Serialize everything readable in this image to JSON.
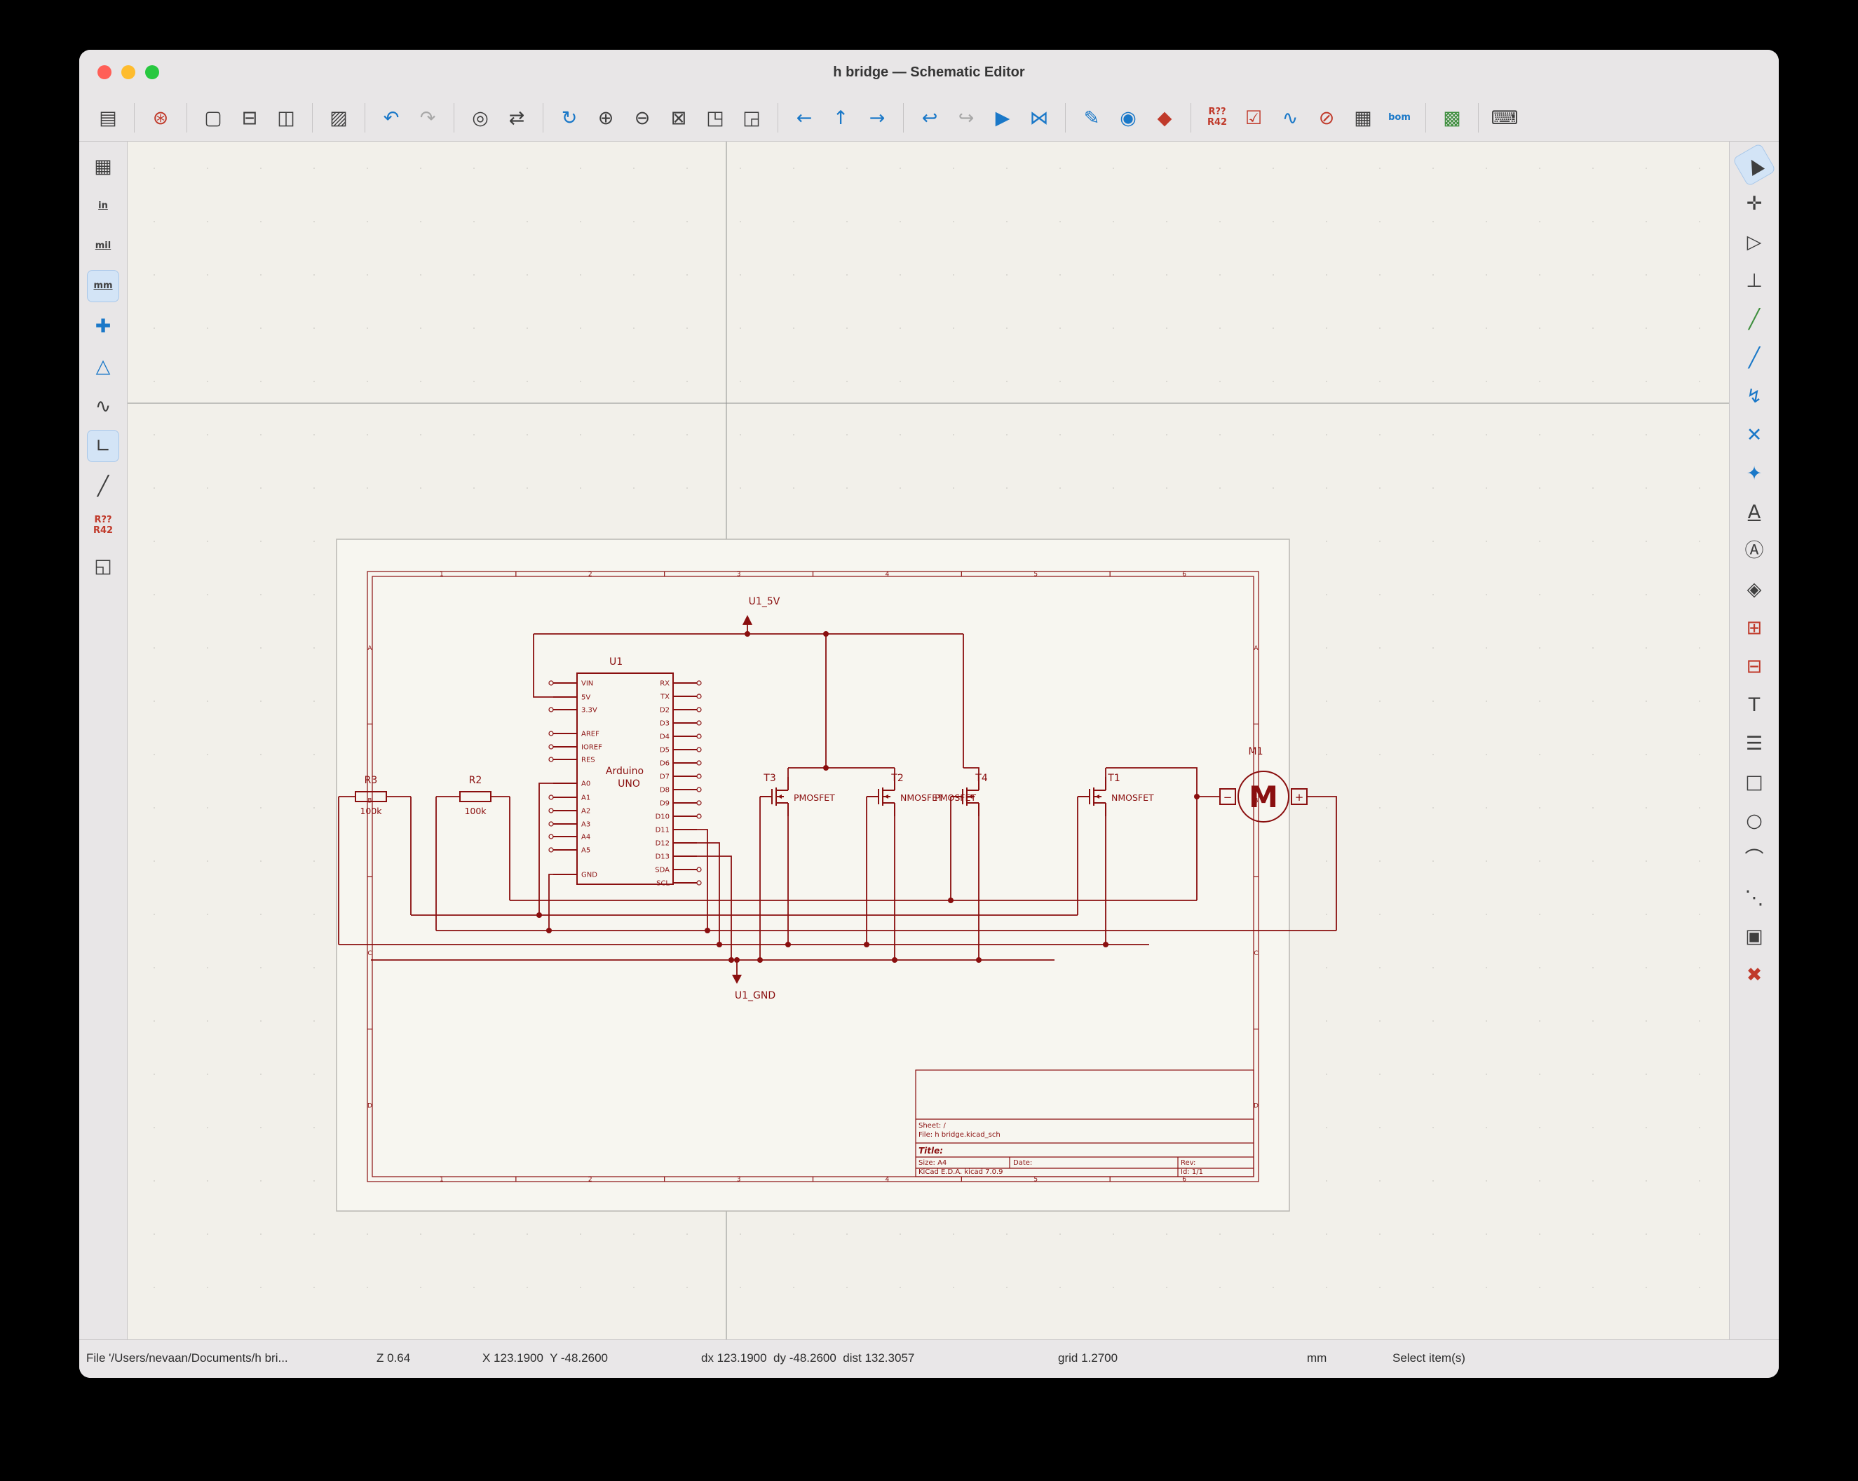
{
  "window": {
    "title": "h bridge — Schematic Editor"
  },
  "colors": {
    "schematic_stroke": "#8a0f0f",
    "titlebar_close": "#ff5f57",
    "titlebar_minimize": "#febc2e",
    "titlebar_maximize": "#28c840",
    "selected_tool_bg": "#d3e4f6",
    "toolbar_icon_blue": "#1a78c8",
    "toolbar_icon_red": "#c03a2b"
  },
  "toolbars": {
    "top": [
      {
        "n": "save-button",
        "g": "▤"
      },
      {
        "sep": true
      },
      {
        "n": "schematic-setup-button",
        "g": "⊛",
        "c": "r"
      },
      {
        "sep": true
      },
      {
        "n": "page-settings-button",
        "g": "▢"
      },
      {
        "n": "print-button",
        "g": "⊟"
      },
      {
        "n": "plot-button",
        "g": "◫"
      },
      {
        "sep": true
      },
      {
        "n": "paste-button",
        "g": "▨"
      },
      {
        "sep": true
      },
      {
        "n": "undo-button",
        "g": "↶",
        "c": "b"
      },
      {
        "n": "redo-button",
        "g": "↷",
        "c": "mut"
      },
      {
        "sep": true
      },
      {
        "n": "find-button",
        "g": "◎"
      },
      {
        "n": "find-replace-button",
        "g": "⇄"
      },
      {
        "sep": true
      },
      {
        "n": "refresh-button",
        "g": "↻",
        "c": "b"
      },
      {
        "n": "zoom-in-button",
        "g": "⊕"
      },
      {
        "n": "zoom-out-button",
        "g": "⊖"
      },
      {
        "n": "zoom-fit-button",
        "g": "⊠"
      },
      {
        "n": "zoom-objects-button",
        "g": "◳"
      },
      {
        "n": "zoom-selection-button",
        "g": "◲"
      },
      {
        "sep": true
      },
      {
        "n": "nav-back-button",
        "g": "←",
        "c": "b"
      },
      {
        "n": "nav-up-button",
        "g": "↑",
        "c": "b"
      },
      {
        "n": "nav-forward-button",
        "g": "→",
        "c": "b"
      },
      {
        "sep": true
      },
      {
        "n": "leave-sheet-button",
        "g": "↩",
        "c": "b"
      },
      {
        "n": "enter-sheet-button",
        "g": "↪",
        "c": "mut"
      },
      {
        "n": "navigate-hierarchy-button",
        "g": "▶",
        "c": "b"
      },
      {
        "n": "mirror-button",
        "g": "⋈",
        "c": "b"
      },
      {
        "sep": true
      },
      {
        "n": "annotate-button",
        "g": "✎",
        "c": "b"
      },
      {
        "n": "symbol-library-browser-button",
        "g": "◉",
        "c": "b"
      },
      {
        "n": "edit-symbol-fields-button",
        "g": "◆",
        "c": "r"
      },
      {
        "sep": true
      },
      {
        "n": "annotate-symbols-button",
        "lines": [
          "R??",
          "R42"
        ],
        "c": "r"
      },
      {
        "n": "erc-button",
        "g": "☑",
        "c": "r"
      },
      {
        "n": "simulator-button",
        "g": "∿",
        "c": "b"
      },
      {
        "n": "erc-rules-button",
        "g": "⊘",
        "c": "r"
      },
      {
        "n": "symbol-fields-table-button",
        "g": "▦"
      },
      {
        "n": "bom-button",
        "lines": [
          "bom"
        ],
        "c": "b"
      },
      {
        "sep": true
      },
      {
        "n": "open-pcb-button",
        "g": "▩",
        "c": "g"
      },
      {
        "sep": true
      },
      {
        "n": "python-console-button",
        "g": "⌨"
      }
    ],
    "left": [
      {
        "n": "grid-settings-button",
        "g": "▦"
      },
      {
        "n": "units-inches-button",
        "lines": [
          "in"
        ],
        "v": "u"
      },
      {
        "n": "units-mils-button",
        "lines": [
          "mil"
        ],
        "v": "u"
      },
      {
        "n": "units-mm-button",
        "lines": [
          "mm"
        ],
        "v": "u",
        "sel": true
      },
      {
        "n": "cursor-shape-button",
        "g": "✚",
        "c": "b"
      },
      {
        "n": "hidden-pins-button",
        "g": "△",
        "c": "b"
      },
      {
        "n": "sim-probe-button",
        "g": "∿"
      },
      {
        "n": "hv-wires-button",
        "g": "∟",
        "sel": true
      },
      {
        "n": "free-angle-wires-button",
        "g": "╱"
      },
      {
        "n": "annotate-auto-button",
        "lines": [
          "R??",
          "R42"
        ],
        "c": "r"
      },
      {
        "n": "hierarchy-navigator-button",
        "g": "◱"
      }
    ],
    "right": [
      {
        "n": "select-tool",
        "g": "▲",
        "v": "cur",
        "sel": true
      },
      {
        "n": "highlight-net-tool",
        "g": "✛"
      },
      {
        "n": "place-symbol-tool",
        "g": "▷"
      },
      {
        "n": "place-power-tool",
        "g": "⊥"
      },
      {
        "n": "wire-tool",
        "g": "╱",
        "c": "g"
      },
      {
        "n": "bus-tool",
        "g": "╱",
        "c": "b"
      },
      {
        "n": "bus-entry-tool",
        "g": "↯",
        "c": "b"
      },
      {
        "n": "no-connect-tool",
        "g": "✕",
        "c": "b"
      },
      {
        "n": "junction-tool",
        "g": "✦",
        "c": "b"
      },
      {
        "n": "net-label-tool",
        "g": "A",
        "v": "u"
      },
      {
        "n": "global-label-tool",
        "g": "Ⓐ"
      },
      {
        "n": "hierarchical-label-tool",
        "g": "◈"
      },
      {
        "n": "sheet-tool",
        "g": "⊞",
        "c": "r"
      },
      {
        "n": "sheet-pin-tool",
        "g": "⊟",
        "c": "r"
      },
      {
        "n": "text-tool",
        "g": "T"
      },
      {
        "n": "textbox-tool",
        "g": "☰"
      },
      {
        "n": "rectangle-tool",
        "g": "□"
      },
      {
        "n": "circle-tool",
        "g": "○"
      },
      {
        "n": "arc-tool",
        "g": "⌒"
      },
      {
        "n": "polygon-tool",
        "g": "⋱"
      },
      {
        "n": "image-tool",
        "g": "▣"
      },
      {
        "n": "delete-tool",
        "g": "✖",
        "c": "r"
      }
    ]
  },
  "schematic": {
    "power_5v": "U1_5V",
    "power_gnd": "U1_GND",
    "u1": {
      "ref": "U1",
      "value_line1": "Arduino",
      "value_line2": "UNO",
      "left_pins": [
        "VIN",
        "5V",
        "3.3V",
        "AREF",
        "IOREF",
        "RES",
        "A0",
        "A1",
        "A2",
        "A3",
        "A4",
        "A5",
        "GND"
      ],
      "right_pins": [
        "RX",
        "TX",
        "D2",
        "D3",
        "D4",
        "D5",
        "D6",
        "D7",
        "D8",
        "D9",
        "D10",
        "D11",
        "D12",
        "D13",
        "SDA",
        "SCL"
      ]
    },
    "r3": {
      "ref": "R3",
      "value": "100k"
    },
    "r2": {
      "ref": "R2",
      "value": "100k"
    },
    "transistors": [
      {
        "ref": "T3",
        "value": "PMOSFET"
      },
      {
        "ref": "T2",
        "value": "NMOSFET"
      },
      {
        "ref": "T4",
        "value": "PMOSFET"
      },
      {
        "ref": "T1",
        "value": "NMOSFET"
      }
    ],
    "motor": {
      "ref": "M1",
      "letter": "M",
      "plus": "+",
      "minus": "−"
    },
    "frame": {
      "cols": [
        "1",
        "2",
        "3",
        "4",
        "5",
        "6"
      ],
      "rows": [
        "A",
        "B",
        "C",
        "D"
      ]
    },
    "title_block": {
      "sheet": "Sheet: /",
      "file": "File: h bridge.kicad_sch",
      "title": "Title:",
      "size": "Size: A4",
      "date": "Date:",
      "rev": "Rev:",
      "kicad": "KiCad E.D.A.  kicad 7.0.9",
      "id": "Id: 1/1"
    }
  },
  "status": {
    "file": "File '/Users/nevaan/Documents/h bri...",
    "zoom": "Z 0.64",
    "pos": "X 123.1900  Y -48.2600",
    "delta": "dx 123.1900  dy -48.2600  dist 132.3057",
    "grid": "grid 1.2700",
    "units": "mm",
    "mode": "Select item(s)"
  }
}
